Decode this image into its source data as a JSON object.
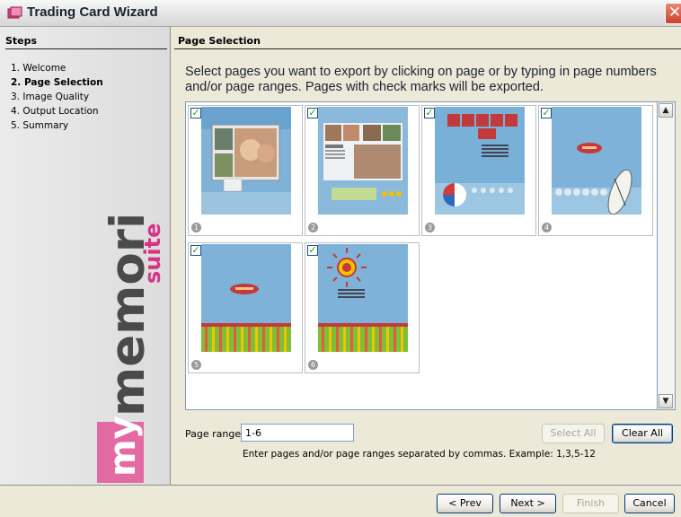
{
  "window": {
    "title": "Trading Card Wizard",
    "close_glyph": "✕"
  },
  "sidebar": {
    "header": "Steps",
    "steps": [
      {
        "label": "1. Welcome",
        "active": false
      },
      {
        "label": "2. Page Selection",
        "active": true
      },
      {
        "label": "3. Image Quality",
        "active": false
      },
      {
        "label": "4. Output Location",
        "active": false
      },
      {
        "label": "5. Summary",
        "active": false
      }
    ],
    "logo": {
      "my": "my",
      "memories": "memories",
      "suite": "suite",
      "colors": {
        "my_bg": "#e46aa3",
        "memories": "#4a4a4a",
        "suite": "#d63487"
      }
    }
  },
  "main": {
    "header": "Page Selection",
    "instructions": "Select pages you want to export by clicking on page or by typing in page numbers and/or page ranges. Pages with check marks will be exported."
  },
  "pages": [
    {
      "number": "1",
      "checked": true,
      "art": "photo-collage"
    },
    {
      "number": "2",
      "checked": true,
      "art": "beach-collage"
    },
    {
      "number": "3",
      "checked": true,
      "art": "surfs-up"
    },
    {
      "number": "4",
      "checked": true,
      "art": "surfboard"
    },
    {
      "number": "5",
      "checked": true,
      "art": "stripes-label"
    },
    {
      "number": "6",
      "checked": true,
      "art": "sun-stripes"
    }
  ],
  "page_range": {
    "label": "Page range:",
    "value": "1-6",
    "hint": "Enter pages and/or page ranges separated by commas. Example: 1,3,5-12",
    "select_all": "Select All",
    "clear_all": "Clear All"
  },
  "footer": {
    "prev": "< Prev",
    "next": "Next >",
    "finish": "Finish",
    "cancel": "Cancel"
  },
  "icons": {
    "title": "app-icon",
    "check": "✓",
    "scroll_up": "▲",
    "scroll_down": "▼"
  },
  "colors": {
    "accent_blue": "#7f9db9",
    "check_green": "#21a121",
    "page_blue": "#7fb2d8"
  }
}
